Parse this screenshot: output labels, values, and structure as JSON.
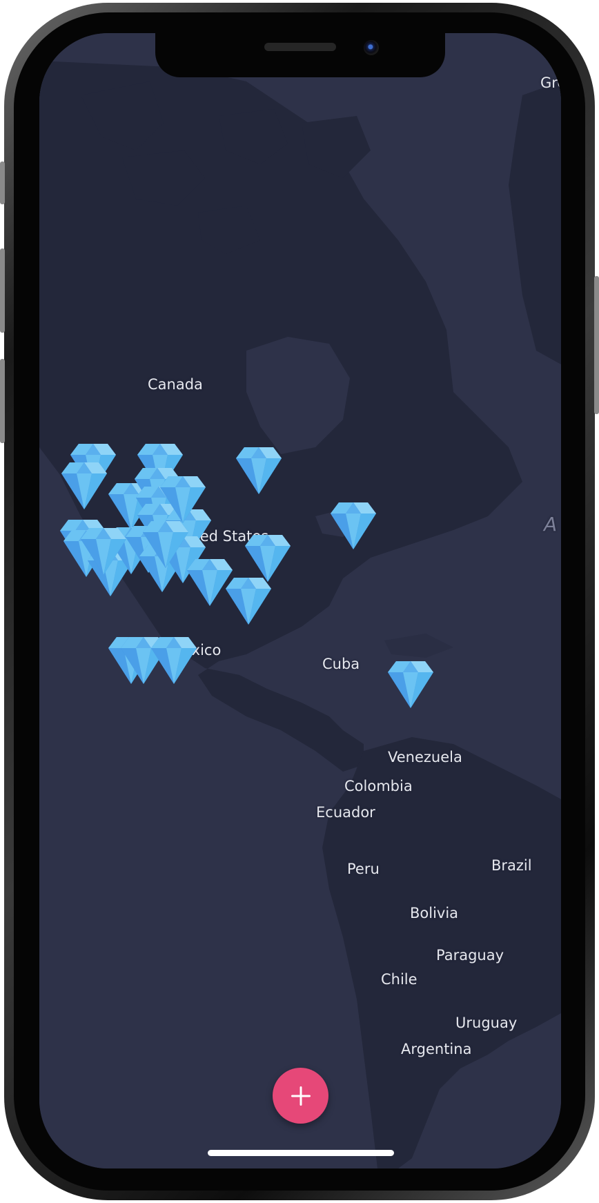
{
  "map": {
    "labels": {
      "canada": "Canada",
      "united_states": "United States",
      "mexico": "Mexico",
      "cuba": "Cuba",
      "venezuela": "Venezuela",
      "colombia": "Colombia",
      "ecuador": "Ecuador",
      "peru": "Peru",
      "brazil": "Brazil",
      "bolivia": "Bolivia",
      "paraguay": "Paraguay",
      "chile": "Chile",
      "uruguay": "Uruguay",
      "argentina": "Argentina",
      "greenland": "Gre",
      "atlantic": "A"
    },
    "marker_icon": "diamond-icon",
    "marker_count": 27,
    "colors": {
      "ocean": "#2e3249",
      "land": "#23273a",
      "marker_light": "#6bc3f3",
      "marker_dark": "#3d8fe0",
      "fab": "#e64878"
    }
  },
  "fab": {
    "icon": "plus-icon"
  }
}
